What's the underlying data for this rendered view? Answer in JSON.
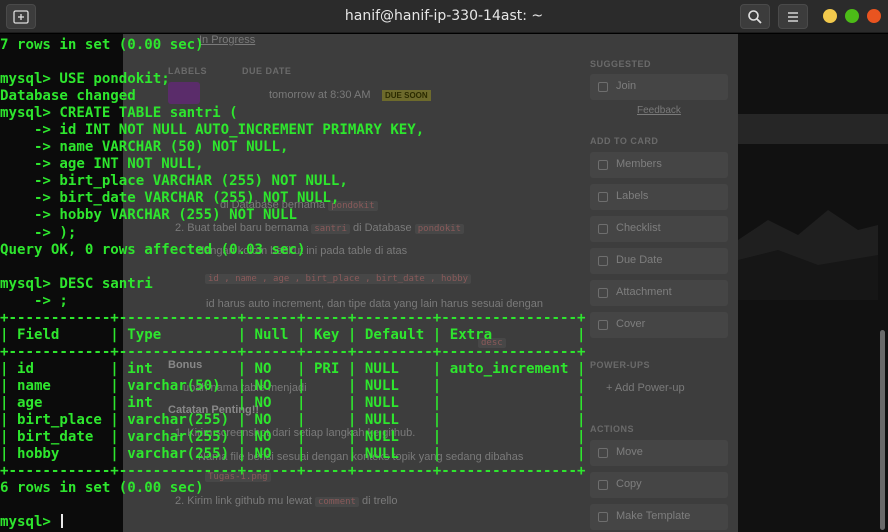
{
  "window": {
    "title": "hanif@hanif-ip-330-14ast: ~",
    "colors": {
      "close": "#e95420",
      "minimize": "#f2c94c",
      "maximize": "#4cbb17",
      "terminal_text": "#2ee62e"
    }
  },
  "terminal": {
    "lines": [
      "7 rows in set (0.00 sec)",
      "",
      "mysql> USE pondokit;",
      "Database changed",
      "mysql> CREATE TABLE santri (",
      "    -> id INT NOT NULL AUTO_INCREMENT PRIMARY KEY,",
      "    -> name VARCHAR (50) NOT NULL,",
      "    -> age INT NOT NULL,",
      "    -> birt_place VARCHAR (255) NOT NULL,",
      "    -> birt_date VARCHAR (255) NOT NULL,",
      "    -> hobby VARCHAR (255) NOT NULL",
      "    -> );",
      "Query OK, 0 rows affected (0.03 sec)",
      "",
      "mysql> DESC santri",
      "    -> ;",
      "+------------+--------------+------+-----+---------+----------------+",
      "| Field      | Type         | Null | Key | Default | Extra          |",
      "+------------+--------------+------+-----+---------+----------------+",
      "| id         | int          | NO   | PRI | NULL    | auto_increment |",
      "| name       | varchar(50)  | NO   |     | NULL    |                |",
      "| age        | int          | NO   |     | NULL    |                |",
      "| birt_place | varchar(255) | NO   |     | NULL    |                |",
      "| birt_date  | varchar(255) | NO   |     | NULL    |                |",
      "| hobby      | varchar(255) | NO   |     | NULL    |                |",
      "+------------+--------------+------+-----+---------+----------------+",
      "6 rows in set (0.00 sec)",
      "",
      "mysql> "
    ]
  },
  "background": {
    "modal": {
      "top_link": "In Progress",
      "labels_heading": "LABELS",
      "due_heading": "DUE DATE",
      "due_value": "tomorrow at 8:30 AM",
      "due_badge": "DUE SOON",
      "step1": "di Database bernama",
      "step1_code": "pondokit",
      "step2": "2. Buat tabel baru bernama",
      "step2_code": "santri",
      "step2_tail": "di Database",
      "step2_code2": "pondokit",
      "step2b": "dengan kolom berikut ini pada table di atas",
      "columns_code": "id , name , age , birt_place , birt_date , hobby",
      "bullet": "id harus auto increment, dan tipe data yang lain harus sesuai dengan",
      "step4_code": "desc",
      "bonus": "Bonus",
      "bonus_text": "ubah nama table menjadi",
      "catatan": "Catatan Penting!!",
      "note1": "1. Kirim screenshot dari setiap langkah ke github.",
      "note2": "Nama file berisi sesuai dengan konteks topik yang sedang dibahas",
      "note2_code": "Tugas-1.png",
      "note3": "2. Kirim link github mu lewat",
      "note3_code": "comment",
      "note3_tail": "di trello"
    },
    "sidebar": {
      "suggested": "SUGGESTED",
      "join": "Join",
      "feedback": "Feedback",
      "add_to_card": "ADD TO CARD",
      "items": [
        "Members",
        "Labels",
        "Checklist",
        "Due Date",
        "Attachment",
        "Cover"
      ],
      "powerups": "POWER-UPS",
      "add_powerup": "Add Power-up",
      "actions": "ACTIONS",
      "action_items": [
        "Move",
        "Copy",
        "Make Template"
      ]
    }
  }
}
